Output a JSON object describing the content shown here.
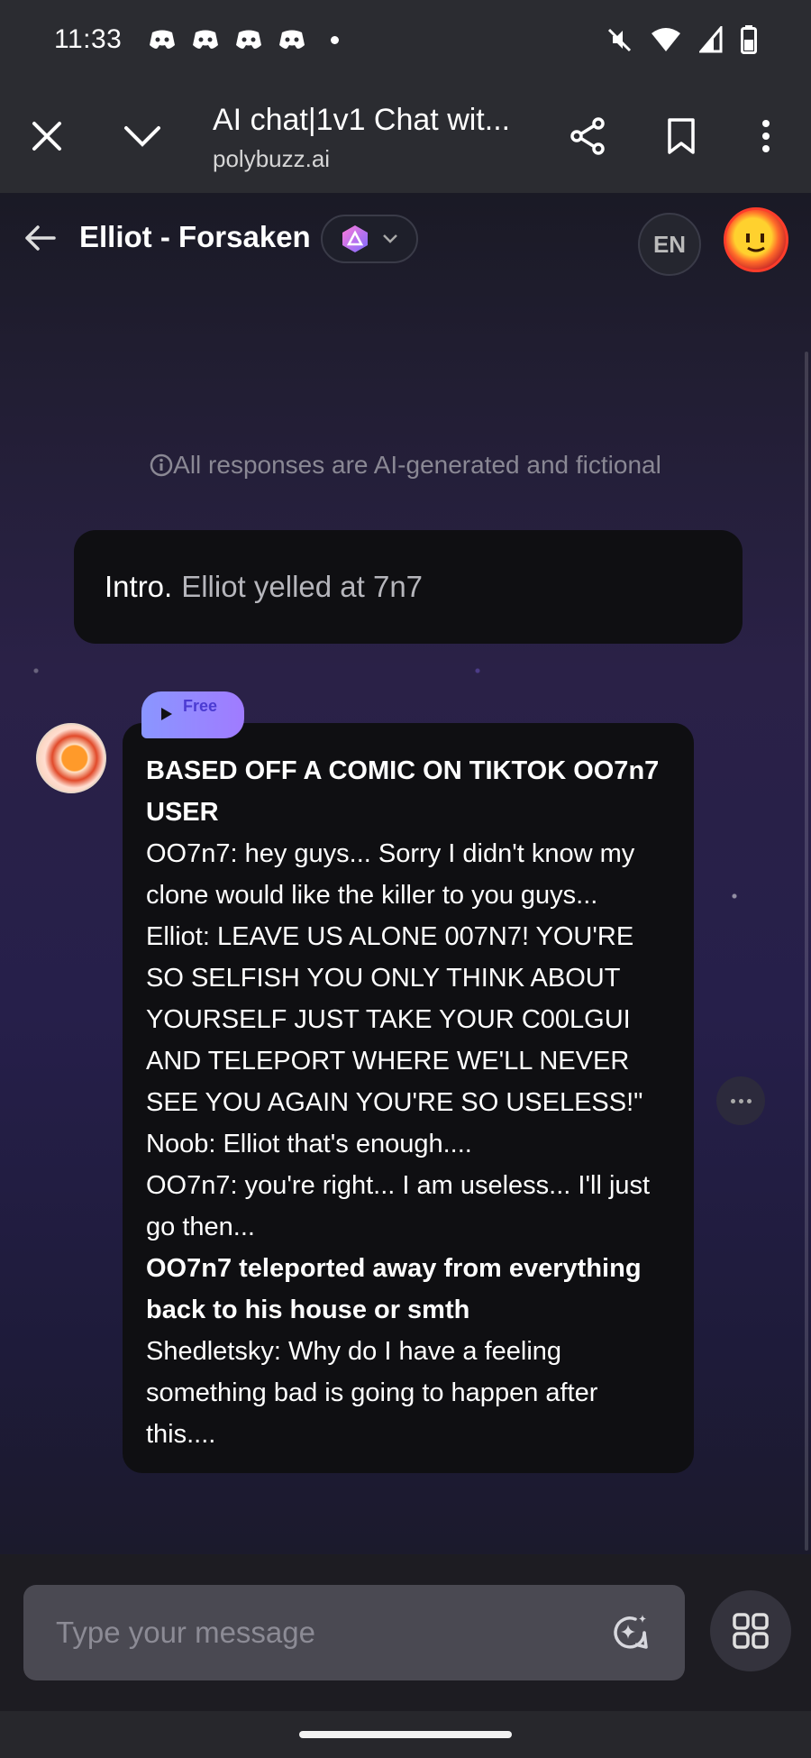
{
  "status_bar": {
    "time": "11:33",
    "notification_icons": [
      "discord-icon",
      "discord-icon",
      "discord-icon",
      "discord-icon"
    ],
    "system_icons": [
      "mute-icon",
      "wifi-icon",
      "signal-icon",
      "battery-icon"
    ]
  },
  "browser": {
    "page_title": "AI chat|1v1 Chat wit...",
    "host": "polybuzz.ai"
  },
  "chat_header": {
    "character_name": "Elliot - Forsaken",
    "language": "EN"
  },
  "disclaimer": "All responses are AI-generated and fictional",
  "intro": {
    "label": "Intro.",
    "text": "Elliot yelled at 7n7"
  },
  "message": {
    "badge": "Free",
    "lines": [
      {
        "text": "BASED OFF A COMIC ON TIKTOK OO7n7 USER",
        "bold": true
      },
      {
        "text": "OO7n7: hey guys... Sorry I didn't know my clone would like the killer to you guys...",
        "bold": false
      },
      {
        "text": "Elliot: LEAVE US ALONE 007N7! YOU'RE SO SELFISH YOU ONLY THINK ABOUT YOURSELF JUST TAKE YOUR C00LGUI AND TELEPORT WHERE WE'LL NEVER SEE YOU AGAIN YOU'RE SO USELESS!\"",
        "bold": false
      },
      {
        "text": "Noob: Elliot that's enough....",
        "bold": false
      },
      {
        "text": "OO7n7: you're right... I am useless... I'll just go then...",
        "bold": false
      },
      {
        "text": "OO7n7 teleported away from everything back to his house or smth",
        "bold": true
      },
      {
        "text": "Shedletsky: Why do I have a feeling something bad is going to happen after this....",
        "bold": false
      }
    ]
  },
  "input": {
    "placeholder": "Type your message"
  },
  "colors": {
    "badge_gradient_start": "#8a96ff",
    "badge_gradient_end": "#a07bff",
    "bubble_bg": "#0f0f12"
  }
}
